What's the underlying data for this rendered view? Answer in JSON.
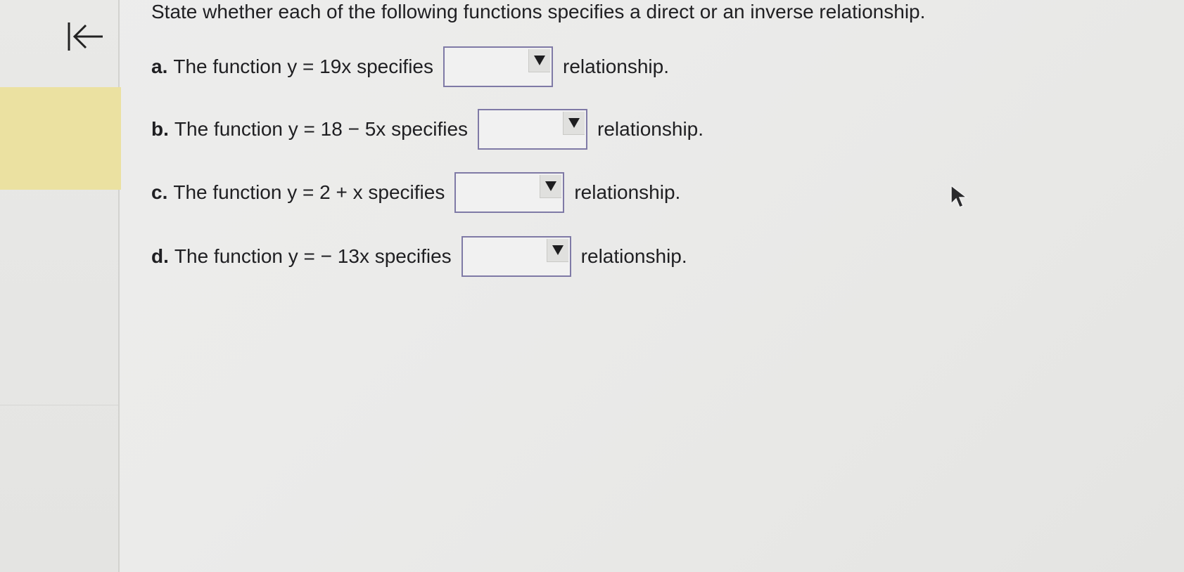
{
  "instruction": "State whether each of the following functions specifies a direct or an inverse relationship.",
  "questions": [
    {
      "letter": "a.",
      "prefix": "The function y = 19x specifies",
      "selected": "",
      "suffix": "relationship."
    },
    {
      "letter": "b.",
      "prefix": "The function y = 18 − 5x specifies",
      "selected": "",
      "suffix": "relationship."
    },
    {
      "letter": "c.",
      "prefix": "The function y = 2 + x specifies",
      "selected": "",
      "suffix": "relationship."
    },
    {
      "letter": "d.",
      "prefix": "The function y = − 13x specifies",
      "selected": "",
      "suffix": "relationship."
    }
  ],
  "icons": {
    "collapse": "collapse-left-arrow-icon",
    "dropdown": "triangle-down-icon",
    "cursor": "mouse-pointer-icon"
  },
  "colors": {
    "highlight": "#ebe1a1",
    "select_border": "#7f7aa6"
  }
}
